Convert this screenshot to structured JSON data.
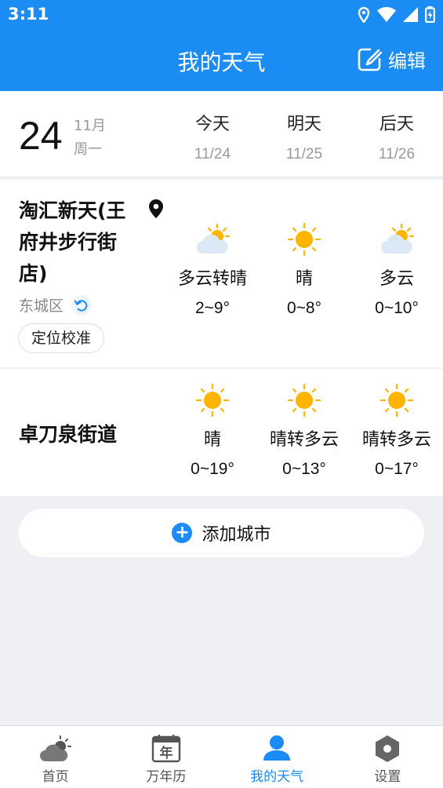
{
  "status": {
    "time": "3:11"
  },
  "appbar": {
    "title": "我的天气",
    "edit_label": "编辑"
  },
  "today": {
    "day": "24",
    "month": "11月",
    "weekday": "周一"
  },
  "days": [
    {
      "name": "今天",
      "date": "11/24"
    },
    {
      "name": "明天",
      "date": "11/25"
    },
    {
      "name": "后天",
      "date": "11/26"
    }
  ],
  "locations": [
    {
      "name": "淘汇新天(王府井步行街店)",
      "district": "东城区",
      "calibrate_label": "定位校准",
      "forecast": [
        {
          "icon": "partly-cloudy-icon",
          "text": "多云转晴",
          "temp": "2~9°"
        },
        {
          "icon": "sunny-icon",
          "text": "晴",
          "temp": "0~8°"
        },
        {
          "icon": "partly-cloudy-icon",
          "text": "多云",
          "temp": "0~10°"
        }
      ]
    },
    {
      "name": "卓刀泉街道",
      "forecast": [
        {
          "icon": "sunny-icon",
          "text": "晴",
          "temp": "0~19°"
        },
        {
          "icon": "sunny-icon",
          "text": "晴转多云",
          "temp": "0~13°"
        },
        {
          "icon": "sunny-icon",
          "text": "晴转多云",
          "temp": "0~17°"
        }
      ]
    }
  ],
  "add_city_label": "添加城市",
  "tabs": [
    {
      "label": "首页",
      "icon": "home-weather-icon"
    },
    {
      "label": "万年历",
      "icon": "calendar-icon",
      "glyph": "年"
    },
    {
      "label": "我的天气",
      "icon": "user-icon",
      "active": true
    },
    {
      "label": "设置",
      "icon": "settings-icon"
    }
  ],
  "colors": {
    "accent": "#1a8cf3",
    "sun": "#ffb400",
    "background": "#eff0f4"
  }
}
